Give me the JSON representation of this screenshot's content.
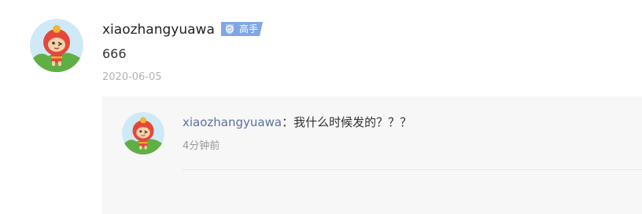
{
  "comment": {
    "username": "xiaozhangyuawa",
    "badge": "高手",
    "text": "666",
    "date": "2020-06-05"
  },
  "reply": {
    "username": "xiaozhangyuawa",
    "colon": "：",
    "text": "我什么时候发的？？？",
    "time": "4分钟前"
  },
  "colors": {
    "badge": "#7fa7e8",
    "reply_username": "#5b6fa0",
    "reply_background": "#f7f7f7"
  },
  "icons": {
    "avatar": "cartoon-lion-avatar",
    "badge": "shield-icon"
  }
}
